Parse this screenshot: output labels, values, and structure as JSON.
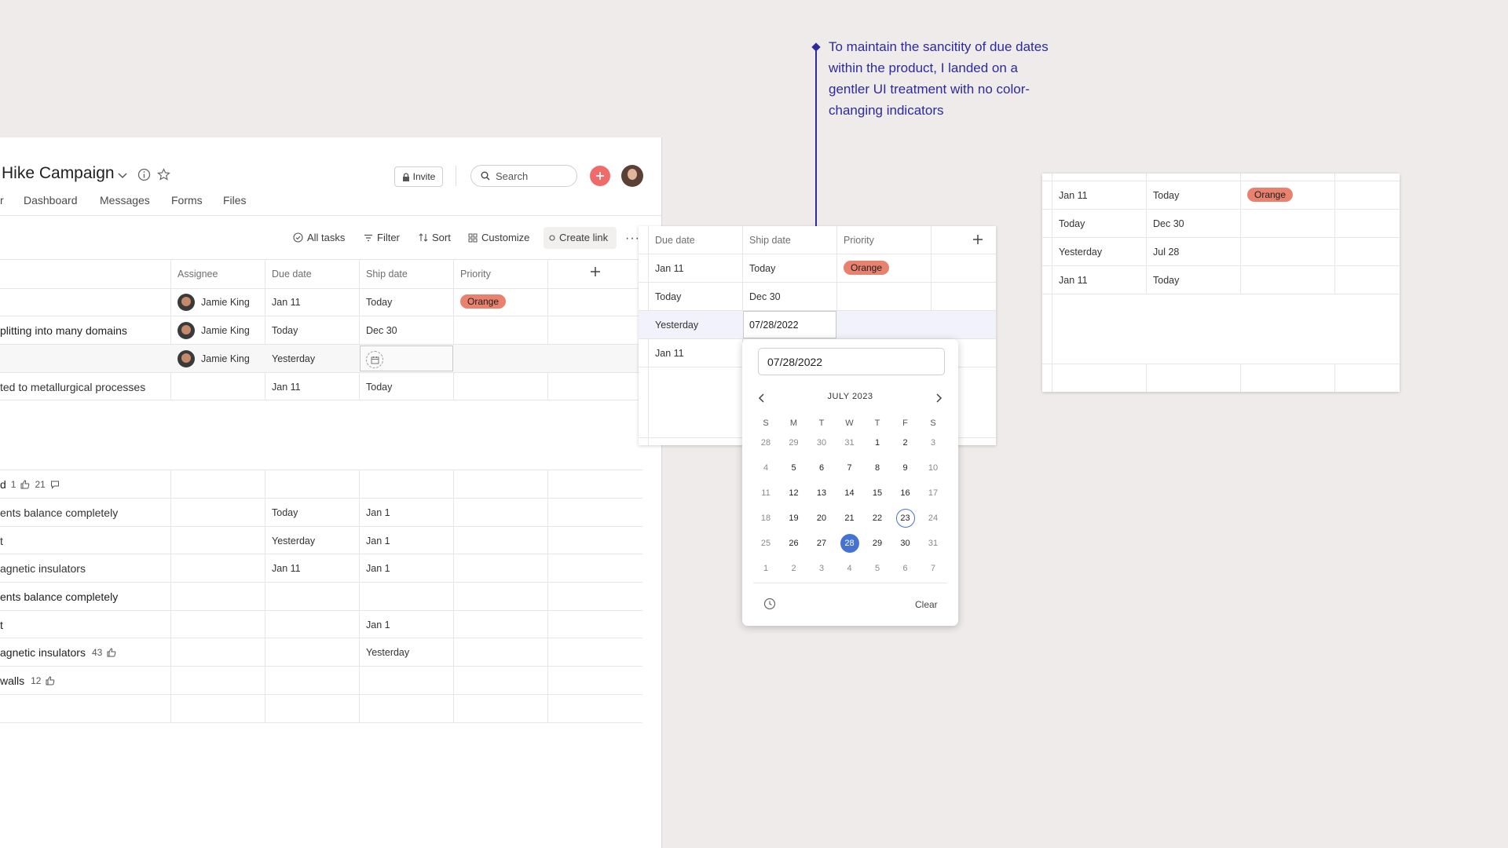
{
  "project": {
    "title": "Hike Campaign",
    "tabs": [
      "r",
      "Dashboard",
      "Messages",
      "Forms",
      "Files"
    ],
    "invite_label": "Invite",
    "search_placeholder": "Search"
  },
  "toolbar": {
    "all_tasks": "All tasks",
    "filter": "Filter",
    "sort": "Sort",
    "customize": "Customize",
    "create_link": "Create link"
  },
  "table": {
    "headers": [
      "Assignee",
      "Due date",
      "Ship date",
      "Priority"
    ],
    "rows": [
      {
        "name": "",
        "assignee": "Jamie King",
        "due": "Jan 11",
        "ship": "Today",
        "priority": "Orange"
      },
      {
        "name": "plitting into many domains",
        "assignee": "Jamie King",
        "due": "Today",
        "ship": "Dec 30",
        "priority": ""
      },
      {
        "name": "",
        "assignee": "Jamie King",
        "due": "Yesterday",
        "ship": "",
        "priority": ""
      },
      {
        "name": "ted to metallurgical processes",
        "assignee": "",
        "due": "Jan 11",
        "ship": "Today",
        "priority": ""
      }
    ],
    "section2": [
      {
        "name": "d",
        "likes": "1",
        "comments": "21",
        "due": "",
        "ship": ""
      },
      {
        "name": "ents balance completely",
        "due": "Today",
        "ship": "Jan 1"
      },
      {
        "name": "t",
        "due": "Yesterday",
        "ship": "Jan 1"
      },
      {
        "name": "agnetic insulators",
        "due": "Jan 11",
        "ship": "Jan 1"
      },
      {
        "name": "ents balance completely",
        "due": "",
        "ship": ""
      },
      {
        "name": "t",
        "due": "",
        "ship": "Jan 1"
      },
      {
        "name": "agnetic insulators",
        "likes": "43",
        "due": "",
        "ship": "Yesterday"
      },
      {
        "name": "walls",
        "likes": "12",
        "due": "",
        "ship": ""
      }
    ]
  },
  "mid_card": {
    "headers": [
      "Due date",
      "Ship date",
      "Priority"
    ],
    "rows": [
      {
        "due": "Jan 11",
        "ship": "Today",
        "priority": "Orange"
      },
      {
        "due": "Today",
        "ship": "Dec 30",
        "priority": ""
      },
      {
        "due": "Yesterday",
        "ship": "07/28/2022",
        "priority": ""
      },
      {
        "due": "Jan 11",
        "ship": "",
        "priority": ""
      }
    ]
  },
  "picker": {
    "input_value": "07/28/2022",
    "month_label": "JULY 2023",
    "dow": [
      "S",
      "M",
      "T",
      "W",
      "T",
      "F",
      "S"
    ],
    "weeks": [
      [
        "28",
        "29",
        "30",
        "31",
        "1",
        "2",
        "3"
      ],
      [
        "4",
        "5",
        "6",
        "7",
        "8",
        "9",
        "10"
      ],
      [
        "11",
        "12",
        "13",
        "14",
        "15",
        "16",
        "17"
      ],
      [
        "18",
        "19",
        "20",
        "21",
        "22",
        "23",
        "24"
      ],
      [
        "25",
        "26",
        "27",
        "28",
        "29",
        "30",
        "31"
      ],
      [
        "1",
        "2",
        "3",
        "4",
        "5",
        "6",
        "7"
      ]
    ],
    "today": "23",
    "selected": "28",
    "clear_label": "Clear"
  },
  "right_card": {
    "rows": [
      {
        "due": "Jan 11",
        "ship": "Today",
        "priority": "Orange"
      },
      {
        "due": "Today",
        "ship": "Dec 30",
        "priority": ""
      },
      {
        "due": "Yesterday",
        "ship": "Jul 28",
        "priority": ""
      },
      {
        "due": "Jan 11",
        "ship": "Today",
        "priority": ""
      }
    ]
  },
  "annotation": {
    "text": "To maintain the sancitity of due dates within the product, I landed on a gentler UI treatment with no color-changing indicators"
  },
  "colors": {
    "accent_blue": "#4573d2",
    "orange_pill": "#e8816e",
    "today_green": "#3b9b7a",
    "yesterday_red": "#e0525d",
    "annotation_navy": "#2d2a9c"
  }
}
